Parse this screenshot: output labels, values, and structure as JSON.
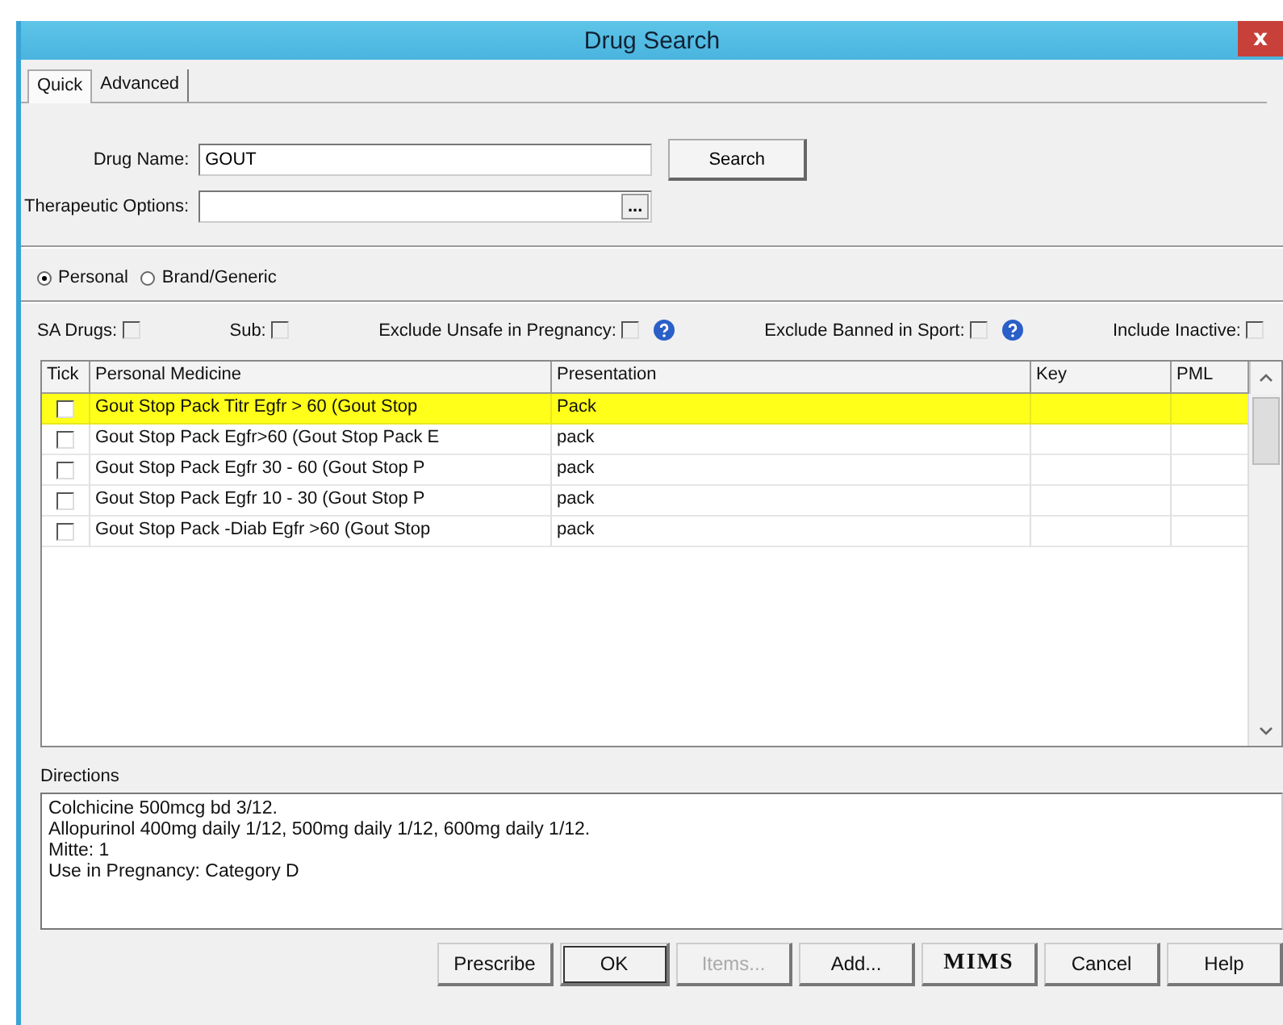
{
  "window": {
    "title": "Drug Search",
    "close": "x"
  },
  "tabs": [
    {
      "label": "Quick",
      "selected": true
    },
    {
      "label": "Advanced",
      "selected": false
    }
  ],
  "drug_name": {
    "label": "Drug Name:",
    "value": "GOUT"
  },
  "search_button": "Search",
  "therapeutic_options": {
    "label": "Therapeutic Options:",
    "browse": "..."
  },
  "source": [
    {
      "label": "Personal",
      "selected": true
    },
    {
      "label": "Brand/Generic",
      "selected": false
    }
  ],
  "filters": [
    {
      "label": "SA Drugs:",
      "checked": false,
      "help": false
    },
    {
      "label": "Sub:",
      "checked": false,
      "help": false
    },
    {
      "label": "Exclude Unsafe in Pregnancy:",
      "checked": false,
      "help": true
    },
    {
      "label": "Exclude Banned in Sport:",
      "checked": false,
      "help": true
    },
    {
      "label": "Include Inactive:",
      "checked": false,
      "help": false
    }
  ],
  "table": {
    "columns": [
      "Tick",
      "Personal Medicine",
      "Presentation",
      "Key",
      "PML"
    ],
    "rows": [
      {
        "medicine": "Gout Stop Pack Titr Egfr > 60 (Gout Stop",
        "presentation": "Pack",
        "checked": false,
        "selected": true
      },
      {
        "medicine": "Gout Stop Pack Egfr>60 (Gout Stop Pack E",
        "presentation": "pack",
        "checked": false,
        "selected": false
      },
      {
        "medicine": "Gout Stop Pack Egfr 30 - 60 (Gout Stop P",
        "presentation": "pack",
        "checked": false,
        "selected": false
      },
      {
        "medicine": "Gout Stop Pack Egfr 10 - 30 (Gout Stop P",
        "presentation": "pack",
        "checked": false,
        "selected": false
      },
      {
        "medicine": "Gout Stop Pack -Diab Egfr >60 (Gout Stop",
        "presentation": "pack",
        "checked": false,
        "selected": false
      }
    ]
  },
  "directions": {
    "label": "Directions",
    "lines": [
      "Colchicine 500mcg bd 3/12.",
      "Allopurinol 400mg daily 1/12, 500mg daily 1/12, 600mg daily 1/12.",
      "Mitte: 1",
      "Use in Pregnancy: Category D"
    ]
  },
  "buttons": [
    {
      "label": "Prescribe",
      "kind": "normal",
      "disabled": false
    },
    {
      "label": "OK",
      "kind": "default",
      "disabled": false
    },
    {
      "label": "Items...",
      "kind": "normal",
      "disabled": true
    },
    {
      "label": "Add...",
      "kind": "normal",
      "disabled": false
    },
    {
      "label": "MIMS",
      "kind": "logo",
      "disabled": false
    },
    {
      "label": "Cancel",
      "kind": "normal",
      "disabled": false
    },
    {
      "label": "Help",
      "kind": "normal",
      "disabled": false
    }
  ]
}
